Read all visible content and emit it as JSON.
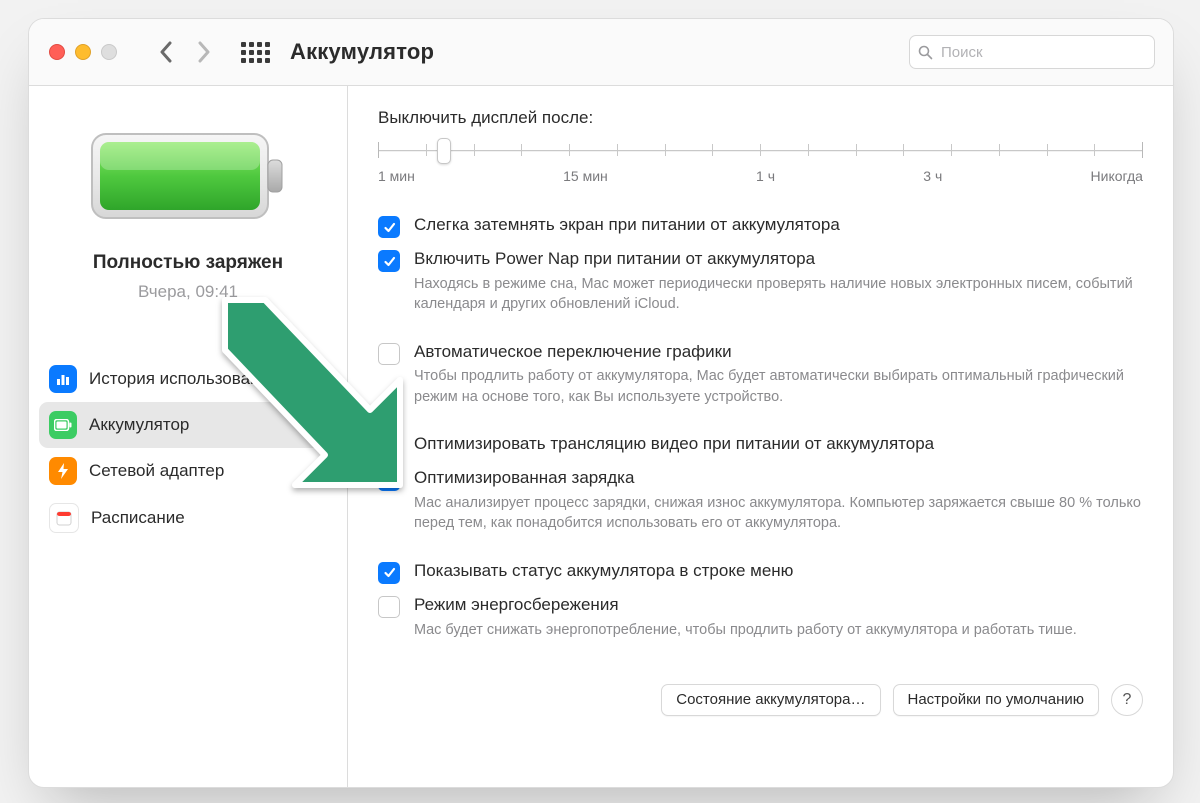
{
  "header": {
    "title": "Аккумулятор",
    "search_placeholder": "Поиск"
  },
  "sidebar": {
    "status": "Полностью заряжен",
    "timestamp": "Вчера, 09:41",
    "items": [
      {
        "label": "История использования"
      },
      {
        "label": "Аккумулятор"
      },
      {
        "label": "Сетевой адаптер"
      },
      {
        "label": "Расписание"
      }
    ]
  },
  "main": {
    "slider_label": "Выключить дисплей после:",
    "slider_ticks": [
      "1 мин",
      "15 мин",
      "1 ч",
      "3 ч",
      "Никогда"
    ],
    "slider_value_pct": 8.5,
    "options": [
      {
        "checked": true,
        "title": "Слегка затемнять экран при питании от аккумулятора",
        "desc": ""
      },
      {
        "checked": true,
        "title": "Включить Power Nap при питании от аккумулятора",
        "desc": "Находясь в режиме сна, Mac может периодически проверять наличие новых электронных писем, событий календаря и других обновлений iCloud."
      },
      {
        "checked": false,
        "title": "Автоматическое переключение графики",
        "desc": "Чтобы продлить работу от аккумулятора, Mac будет автоматически выбирать оптимальный графический режим на основе того, как Вы используете устройство."
      },
      {
        "checked": true,
        "title": "Оптимизировать трансляцию видео при питании от аккумулятора",
        "desc": ""
      },
      {
        "checked": true,
        "title": "Оптимизированная зарядка",
        "desc": "Mac анализирует процесс зарядки, снижая износ аккумулятора. Компьютер заряжается свыше 80 % только перед тем, как понадобится использовать его от аккумулятора."
      },
      {
        "checked": true,
        "title": "Показывать статус аккумулятора в строке меню",
        "desc": ""
      },
      {
        "checked": false,
        "title": "Режим энергосбережения",
        "desc": "Mac будет снижать энергопотребление, чтобы продлить работу от аккумулятора и работать тише."
      }
    ],
    "footer": {
      "health_button": "Состояние аккумулятора…",
      "defaults_button": "Настройки по умолчанию",
      "help": "?"
    }
  }
}
